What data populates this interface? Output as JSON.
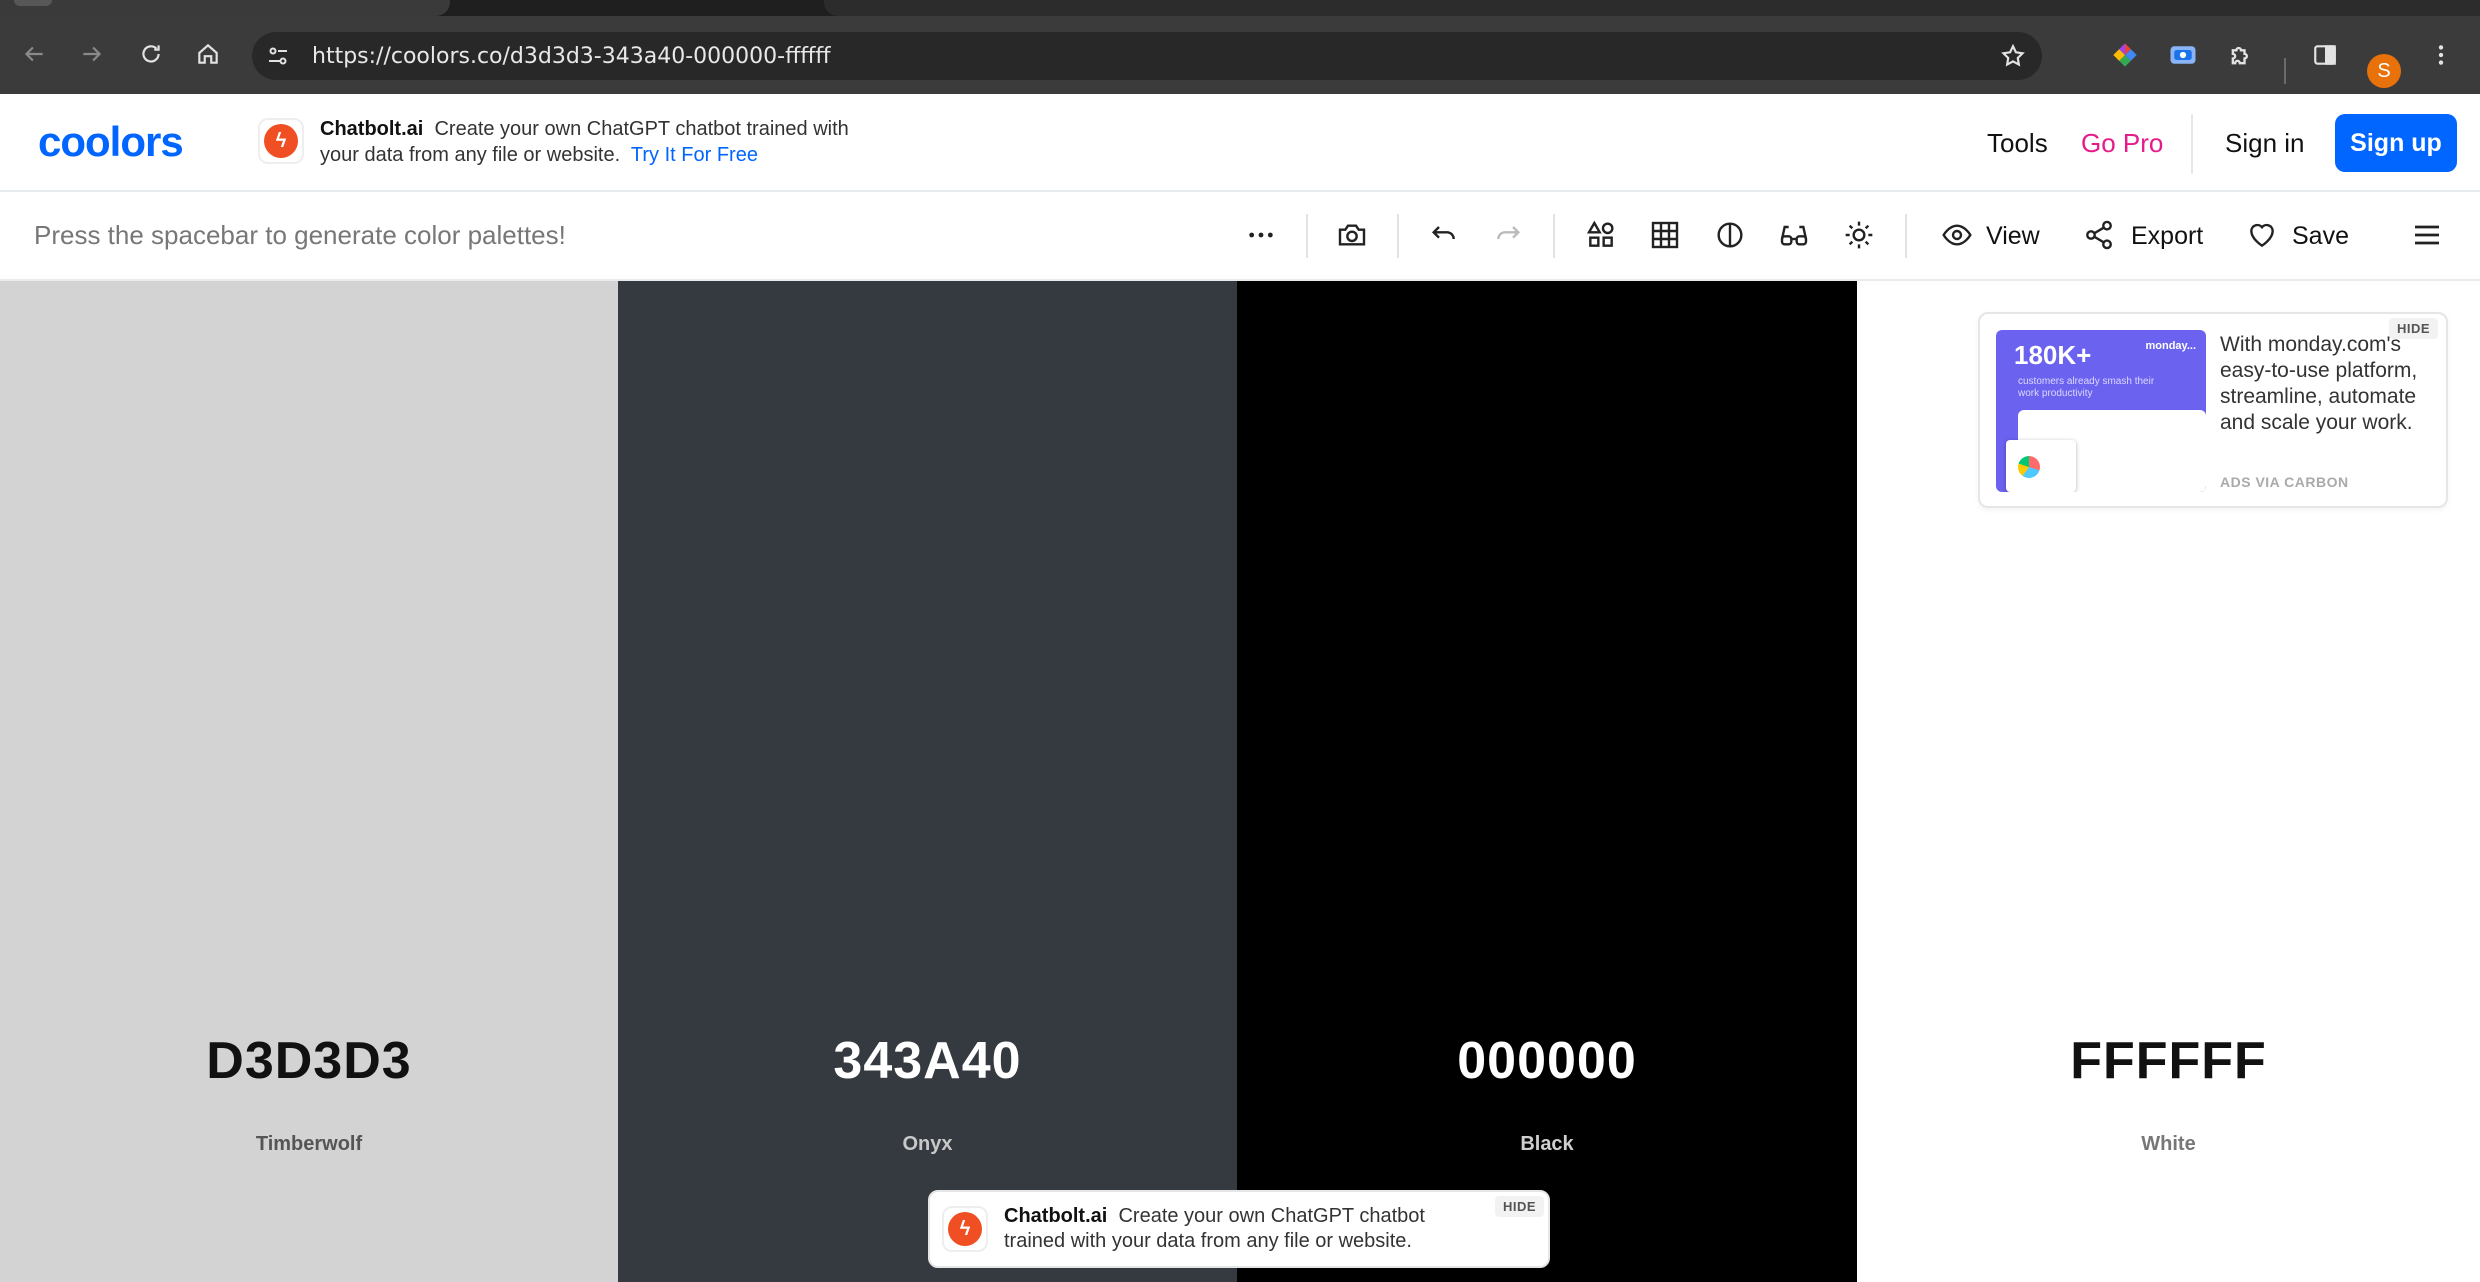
{
  "browser": {
    "url": "https://coolors.co/d3d3d3-343a40-000000-ffffff",
    "profile_initial": "S"
  },
  "header": {
    "logo": "coolors",
    "ad": {
      "brand": "Chatbolt.ai",
      "text": "Create your own ChatGPT chatbot trained with your data from any file or website.",
      "cta": "Try It For Free"
    },
    "nav": {
      "tools": "Tools",
      "gopro": "Go Pro",
      "signin": "Sign in",
      "signup": "Sign up"
    }
  },
  "generator": {
    "hint": "Press the spacebar to generate color palettes!",
    "view_label": "View",
    "export_label": "Export",
    "save_label": "Save"
  },
  "palette": [
    {
      "hex": "D3D3D3",
      "name": "Timberwolf",
      "color": "#d3d3d3",
      "text_color": "#111111",
      "name_color": "#555555"
    },
    {
      "hex": "343A40",
      "name": "Onyx",
      "color": "#343a40",
      "text_color": "#ffffff",
      "name_color": "#c8c8c8"
    },
    {
      "hex": "000000",
      "name": "Black",
      "color": "#000000",
      "text_color": "#ffffff",
      "name_color": "#cfcfcf"
    },
    {
      "hex": "FFFFFF",
      "name": "White",
      "color": "#ffffff",
      "text_color": "#111111",
      "name_color": "#777777"
    }
  ],
  "carbon_ad": {
    "image_headline": "180K+",
    "image_sub": "customers already smash their work productivity",
    "image_brand": "monday...",
    "text": "With monday.com's easy-to-use platform, streamline, automate and scale your work.",
    "via": "ADS VIA CARBON",
    "hide": "HIDE"
  },
  "bottom_ad": {
    "brand": "Chatbolt.ai",
    "text": "Create your own ChatGPT chatbot trained with your data from any file or website.",
    "hide": "HIDE"
  }
}
